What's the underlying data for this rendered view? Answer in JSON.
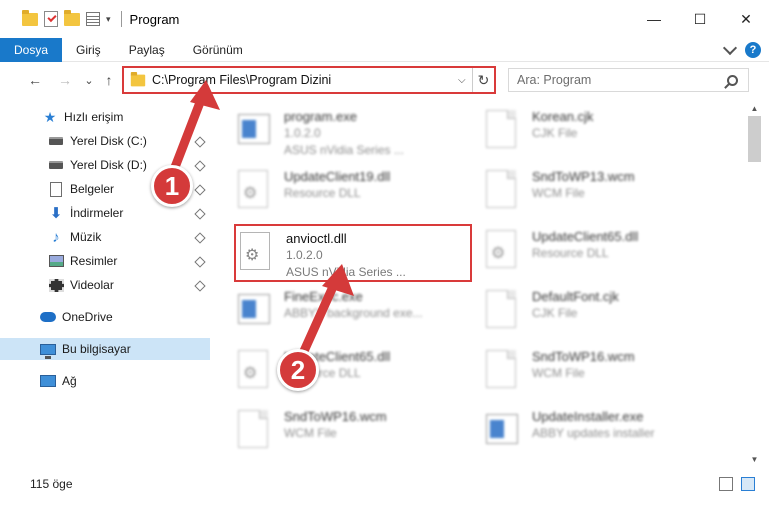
{
  "window": {
    "title": "Program",
    "controls": {
      "minimize": "—",
      "maximize": "☐",
      "close": "✕"
    }
  },
  "ribbon": {
    "tabs": [
      "Dosya",
      "Giriş",
      "Paylaş",
      "Görünüm"
    ],
    "active_tab": "Dosya",
    "help": "?"
  },
  "address": {
    "path": "C:\\Program Files\\Program Dizini",
    "dropdown": "⌵",
    "refresh": "↻",
    "back": "←",
    "forward": "→",
    "recent": "⌄",
    "up": "↑"
  },
  "search": {
    "placeholder": "Ara: Program"
  },
  "sidebar": {
    "quick_access": "Hızlı erişim",
    "items": [
      {
        "label": "Yerel Disk (C:)",
        "icon": "disk-icon"
      },
      {
        "label": "Yerel Disk (D:)",
        "icon": "disk-icon"
      },
      {
        "label": "Belgeler",
        "icon": "document-icon"
      },
      {
        "label": "İndirmeler",
        "icon": "download-icon"
      },
      {
        "label": "Müzik",
        "icon": "music-icon"
      },
      {
        "label": "Resimler",
        "icon": "pictures-icon"
      },
      {
        "label": "Videolar",
        "icon": "videos-icon"
      }
    ],
    "onedrive": "OneDrive",
    "this_pc": "Bu bilgisayar",
    "network": "Ağ"
  },
  "files": [
    {
      "name": "program.exe",
      "line2": "1.0.2.0",
      "line3": "ASUS nVidia Series ...",
      "icon": "exe-icon"
    },
    {
      "name": "Korean.cjk",
      "line2": "CJK File",
      "line3": "",
      "icon": "file-icon"
    },
    {
      "name": "UpdateClient19.dll",
      "line2": "Resource DLL",
      "line3": "",
      "icon": "dll-icon"
    },
    {
      "name": "SndToWP13.wcm",
      "line2": "WCM File",
      "line3": "",
      "icon": "file-icon"
    },
    {
      "name": "anvioctl.dll",
      "line2": "1.0.2.0",
      "line3": "ASUS nVidia Series ...",
      "icon": "dll-icon"
    },
    {
      "name": "UpdateClient65.dll",
      "line2": "Resource DLL",
      "line3": "",
      "icon": "dll-icon"
    },
    {
      "name": "FineExec.exe",
      "line2": "ABBYY background exe...",
      "line3": "",
      "icon": "exe-icon"
    },
    {
      "name": "DefaultFont.cjk",
      "line2": "CJK File",
      "line3": "",
      "icon": "file-icon"
    },
    {
      "name": "UpdateClient65.dll",
      "line2": "Resource DLL",
      "line3": "",
      "icon": "dll-icon"
    },
    {
      "name": "SndToWP16.wcm",
      "line2": "WCM File",
      "line3": "",
      "icon": "file-icon"
    },
    {
      "name": "SndToWP16.wcm",
      "line2": "WCM File",
      "line3": "",
      "icon": "file-icon"
    },
    {
      "name": "UpdateInstaller.exe",
      "line2": "ABBY updates installer",
      "line3": "",
      "icon": "exe-icon"
    }
  ],
  "status": {
    "count": "115 öge"
  },
  "annotations": {
    "step1": "1",
    "step2": "2"
  },
  "colors": {
    "accent": "#1979ca",
    "highlight": "#d93a3a",
    "selected": "#cce4f7"
  }
}
